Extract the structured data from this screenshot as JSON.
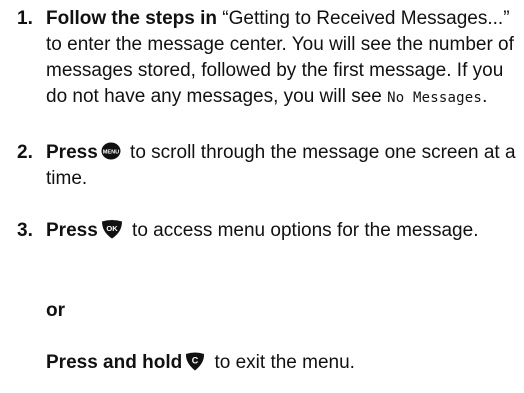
{
  "steps": [
    {
      "number": "1.",
      "bold_lead": "Follow the steps in",
      "text_a": " “Getting to Received Messages...” to enter the message center. You will see the number of messages stored, followed by the first message. If you do not have any messages, you will see ",
      "display_text": "No Messages",
      "text_b": "."
    },
    {
      "number": "2.",
      "bold_lead": "Press",
      "key_icon": "menu-key-icon",
      "key_label": "MENU",
      "text_a": " to scroll through the message one screen at a time."
    },
    {
      "number": "3.",
      "bold_lead": "Press",
      "key_icon": "ok-key-icon",
      "key_label": "OK",
      "text_a": " to access menu options for the message.",
      "or_label": "or",
      "alt_bold_lead": "Press and hold",
      "alt_key_icon": "clear-key-icon",
      "alt_key_label": "C",
      "alt_text": " to exit the menu."
    }
  ]
}
